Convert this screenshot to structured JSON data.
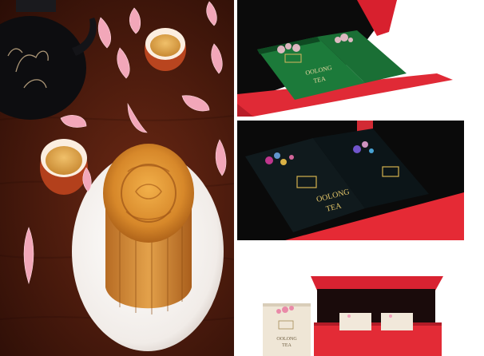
{
  "photos": {
    "hero": {
      "subject": "mooncake with tea"
    },
    "green_box": {
      "tin_label_line1": "OOLONG",
      "tin_label_line2": "TEA"
    },
    "dark_box": {
      "tin_label_line1": "OOLONG",
      "tin_label_line2": "TEA"
    },
    "red_box": {
      "tin_label_line1": "OOLONG",
      "tin_label_line2": "TEA"
    }
  },
  "colors": {
    "table": "#47190c",
    "mooncake": "#d8892c",
    "green_tin": "#1c7a3a",
    "dark_tin": "#0f1a1c",
    "box_red": "#e42a36",
    "cream_tin": "#efe6d6"
  }
}
